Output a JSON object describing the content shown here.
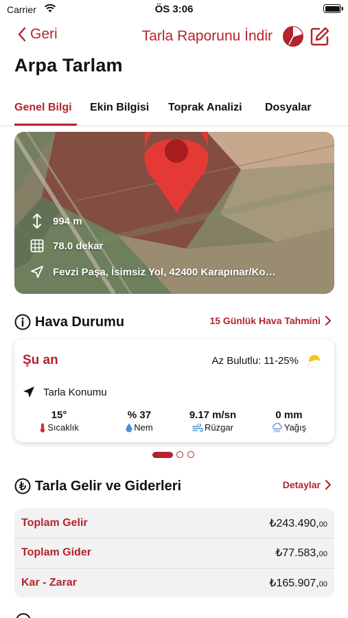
{
  "status_bar": {
    "carrier": "Carrier",
    "time": "ÖS 3:06"
  },
  "nav": {
    "back_label": "Geri",
    "report_label": "Tarla Raporunu İndir"
  },
  "page": {
    "title": "Arpa Tarlam"
  },
  "tabs": [
    {
      "label": "Genel Bilgi",
      "active": true
    },
    {
      "label": "Ekin Bilgisi",
      "active": false
    },
    {
      "label": "Toprak Analizi",
      "active": false
    },
    {
      "label": "Dosyalar",
      "active": false
    }
  ],
  "map": {
    "altitude": "994 m",
    "area": "78.0 dekar",
    "address": "Fevzi Paşa, İsimsiz Yol, 42400 Karapınar/Ko…"
  },
  "weather": {
    "section_title": "Hava Durumu",
    "forecast_link": "15 Günlük Hava Tahmini",
    "now_label": "Şu an",
    "condition": "Az Bulutlu: 11-25%",
    "location_label": "Tarla Konumu",
    "stats": [
      {
        "value": "15°",
        "label": "Sıcaklık",
        "icon": "thermometer-icon"
      },
      {
        "value": "% 37",
        "label": "Nem",
        "icon": "droplet-icon"
      },
      {
        "value": "9.17 m/sn",
        "label": "Rüzgar",
        "icon": "wind-icon"
      },
      {
        "value": "0 mm",
        "label": "Yağış",
        "icon": "rain-cloud-icon"
      }
    ],
    "pager": {
      "pages": 3,
      "current": 1
    }
  },
  "finance": {
    "section_title": "Tarla Gelir ve Giderleri",
    "details_link": "Detaylar",
    "rows": [
      {
        "label": "Toplam Gelir",
        "amount": "₺243.490,",
        "decimals": "00"
      },
      {
        "label": "Toplam Gider",
        "amount": "₺77.583,",
        "decimals": "00"
      },
      {
        "label": "Kar - Zarar",
        "amount": "₺165.907,",
        "decimals": "00"
      }
    ]
  },
  "colors": {
    "accent": "#b3242d",
    "text": "#111111",
    "card_bg": "#f2f2f4"
  }
}
